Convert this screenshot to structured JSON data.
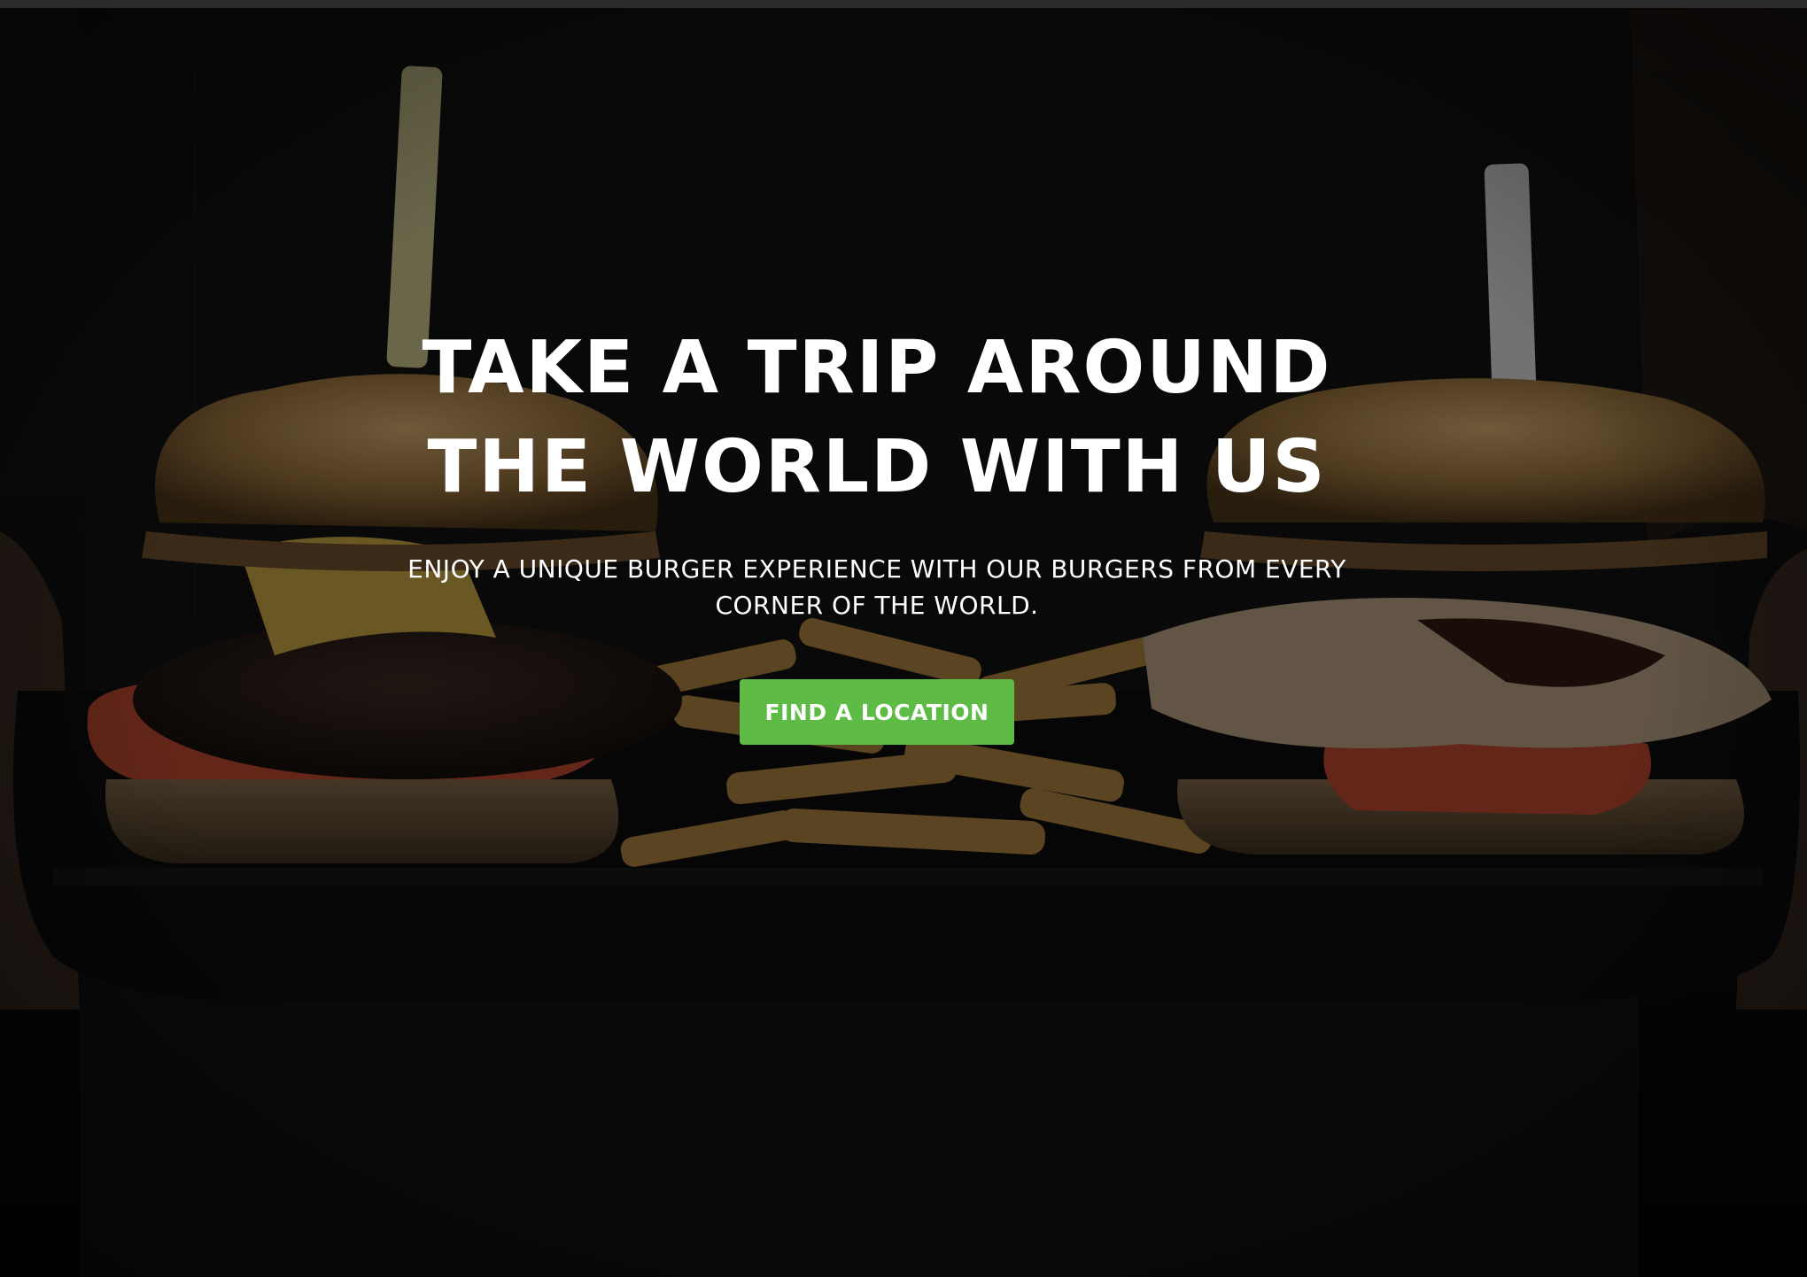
{
  "hero": {
    "title": "TAKE A TRIP AROUND THE WORLD WITH US",
    "subtitle": "ENJOY A UNIQUE BURGER EXPERIENCE WITH OUR BURGERS FROM EVERY CORNER OF THE WORLD.",
    "cta_label": "FIND A LOCATION",
    "background_image": "burgers-and-fries-tray-photo",
    "overlay_color": "#000000"
  },
  "colors": {
    "cta_background": "#5dbb46",
    "text": "#ffffff",
    "top_bar": "#2a2a2a"
  }
}
